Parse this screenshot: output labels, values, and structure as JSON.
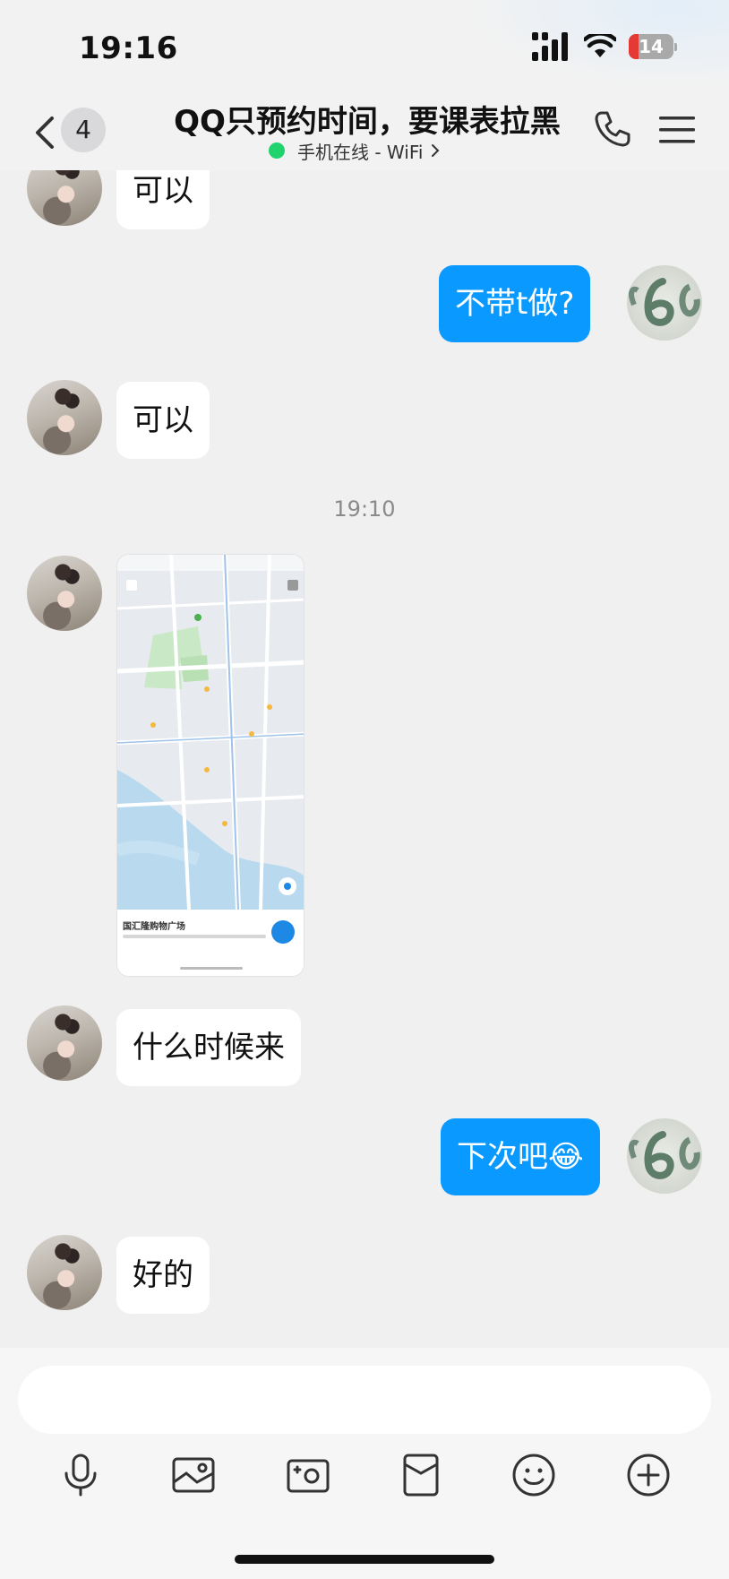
{
  "status_bar": {
    "time": "19:16",
    "battery_level": "14",
    "battery_fraction": 0.14
  },
  "header": {
    "unread_count": "4",
    "title": "QQ只预约时间，要课表拉黑",
    "online_status": "手机在线 - WiFi"
  },
  "messages": [
    {
      "sender": "peer",
      "text": "可以"
    },
    {
      "sender": "self",
      "text": "不带t做?"
    },
    {
      "sender": "peer",
      "text": "可以"
    },
    {
      "timestamp": "19:10"
    },
    {
      "sender": "peer",
      "type": "image",
      "place_name": "国汇隆购物广场"
    },
    {
      "sender": "peer",
      "text": "什么时候来"
    },
    {
      "sender": "self",
      "text": "下次吧😂"
    },
    {
      "sender": "peer",
      "text": "好的"
    }
  ],
  "input": {
    "placeholder": ""
  },
  "toolbar": [
    "microphone-icon",
    "image-icon",
    "camera-icon",
    "red-envelope-icon",
    "emoji-icon",
    "plus-icon"
  ],
  "colors": {
    "self_bubble": "#0a99ff",
    "peer_bubble": "#ffffff",
    "online": "#21d36c"
  }
}
